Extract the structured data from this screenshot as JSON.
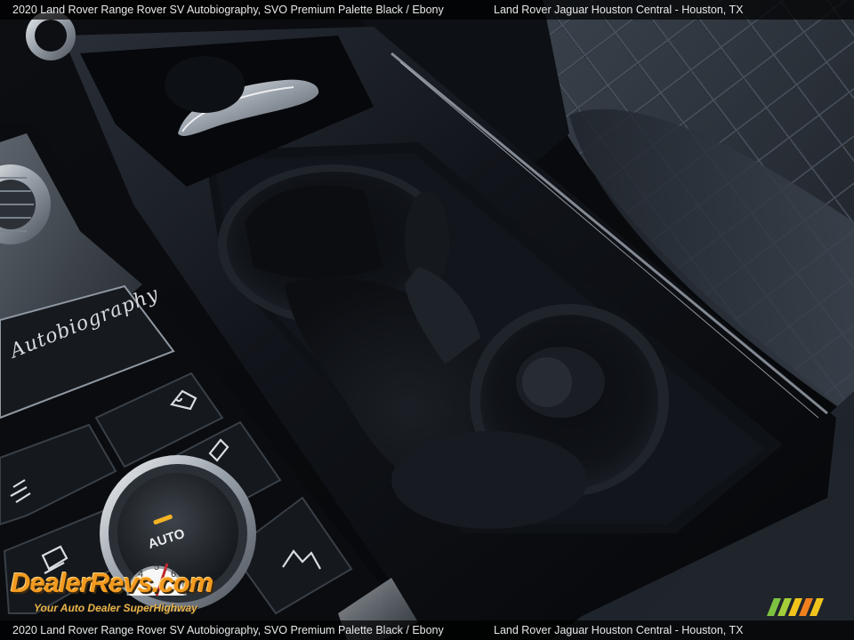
{
  "caption": {
    "left": "2020 Land Rover Range Rover SV Autobiography,  SVO Premium Palette Black / Ebony",
    "right": "Land Rover Jaguar Houston Central - Houston, TX"
  },
  "watermark": {
    "brand": "DealerRevs.com",
    "tagline": "Your Auto Dealer SuperHighway",
    "gauge_numbers": [
      "4",
      "5",
      "6"
    ]
  },
  "console": {
    "badge_script": "Autobiography",
    "knob_label": "AUTO"
  },
  "colors": {
    "piano_black": "#07080b",
    "leather": "#2c333c",
    "chrome": "#c9cfd6",
    "logo_orange": "#f29a1f",
    "stripe_green": "#7ec242",
    "stripe_yellow": "#f1c41c",
    "stripe_orange": "#f07f1e"
  },
  "icons": [
    "hill-descent-icon",
    "traction-icon",
    "wading-icon",
    "offroad-mode-icon",
    "terrain-icon"
  ]
}
